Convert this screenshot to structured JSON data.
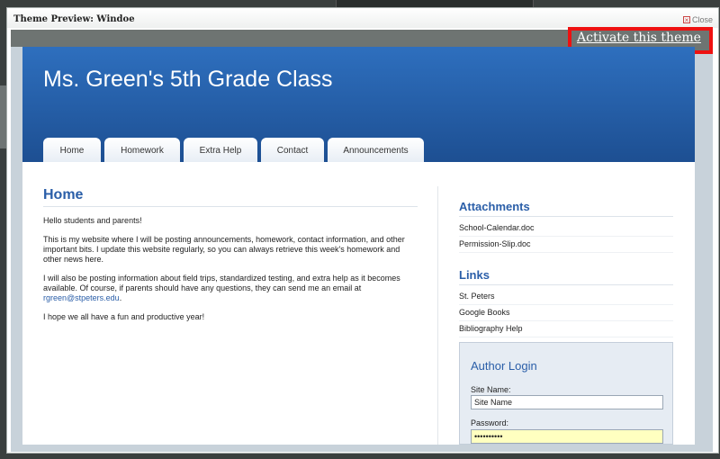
{
  "dialog": {
    "title": "Theme Preview: Windoe",
    "close_label": "Close",
    "activate_label": "Activate this theme"
  },
  "site": {
    "title": "Ms. Green's 5th Grade Class",
    "nav": [
      {
        "label": "Home"
      },
      {
        "label": "Homework"
      },
      {
        "label": "Extra Help"
      },
      {
        "label": "Contact"
      },
      {
        "label": "Announcements"
      }
    ],
    "page_heading": "Home",
    "paragraphs": [
      "Hello students and parents!",
      "This is my website where I will be posting announcements, homework, contact information, and other important bits. I update this website regularly, so you can always retrieve this week's homework and other news here.",
      "I will also be posting information about field trips, standardized testing, and extra help as it becomes available. Of course, if parents should have any questions, they can send me an email at",
      "I hope we all have a fun and productive year!"
    ],
    "email": "rgreen@stpeters.edu",
    "email_suffix": ".",
    "sidebar": {
      "attachments_heading": "Attachments",
      "attachments": [
        "School-Calendar.doc",
        "Permission-Slip.doc"
      ],
      "links_heading": "Links",
      "links": [
        "St. Peters",
        "Google Books",
        "Bibliography Help"
      ]
    },
    "login": {
      "heading": "Author Login",
      "site_name_label": "Site Name:",
      "site_name_value": "Site Name",
      "password_label": "Password:",
      "password_value": "••••••••••"
    }
  }
}
